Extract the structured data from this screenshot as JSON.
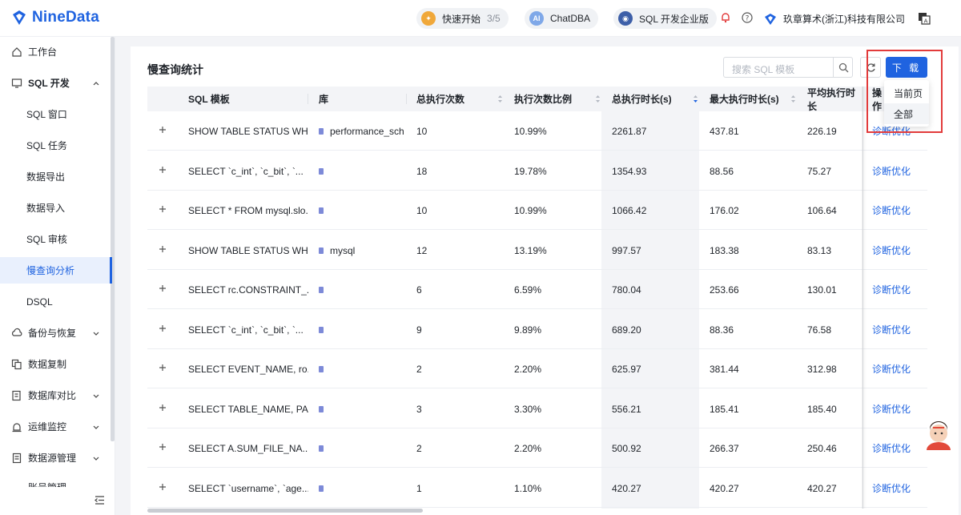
{
  "header": {
    "logo_text": "NineData",
    "quickstart_label": "快速开始",
    "quickstart_count": "3/5",
    "chatdba_label": "ChatDBA",
    "edition_label": "SQL 开发企业版",
    "company_name": "玖章算术(浙江)科技有限公司"
  },
  "sidebar": {
    "items": [
      {
        "label": "工作台",
        "icon": "home-icon"
      },
      {
        "label": "SQL 开发",
        "icon": "monitor-icon"
      },
      {
        "label": "SQL 窗口"
      },
      {
        "label": "SQL 任务"
      },
      {
        "label": "数据导出"
      },
      {
        "label": "数据导入"
      },
      {
        "label": "SQL 审核"
      },
      {
        "label": "慢查询分析"
      },
      {
        "label": "DSQL"
      },
      {
        "label": "备份与恢复",
        "icon": "cloud-icon"
      },
      {
        "label": "数据复制",
        "icon": "copy-icon"
      },
      {
        "label": "数据库对比",
        "icon": "compare-icon"
      },
      {
        "label": "运维监控",
        "icon": "alarm-icon"
      },
      {
        "label": "数据源管理",
        "icon": "datasource-icon"
      },
      {
        "label": "账号管理",
        "icon": "account-icon"
      }
    ]
  },
  "main": {
    "title": "慢查询统计",
    "search_placeholder": "搜索 SQL 模板",
    "download_label": "下 载",
    "download_options": [
      "当前页",
      "全部"
    ],
    "columns": [
      "SQL 模板",
      "库",
      "总执行次数",
      "执行次数比例",
      "总执行时长(s)",
      "最大执行时长(s)",
      "平均执行时长",
      "操作"
    ],
    "rows": [
      {
        "sql": "SHOW TABLE STATUS WH...",
        "db": "performance_sch",
        "count": "10",
        "ratio": "10.99%",
        "total": "2261.87",
        "max": "437.81",
        "avg": "226.19",
        "op": "诊断优化"
      },
      {
        "sql": "SELECT `c_int`, `c_bit`, `...",
        "db": "",
        "count": "18",
        "ratio": "19.78%",
        "total": "1354.93",
        "max": "88.56",
        "avg": "75.27",
        "op": "诊断优化"
      },
      {
        "sql": "SELECT * FROM mysql.slo...",
        "db": "",
        "count": "10",
        "ratio": "10.99%",
        "total": "1066.42",
        "max": "176.02",
        "avg": "106.64",
        "op": "诊断优化"
      },
      {
        "sql": "SHOW TABLE STATUS WH...",
        "db": "mysql",
        "count": "12",
        "ratio": "13.19%",
        "total": "997.57",
        "max": "183.38",
        "avg": "83.13",
        "op": "诊断优化"
      },
      {
        "sql": "SELECT rc.CONSTRAINT_...",
        "db": "",
        "count": "6",
        "ratio": "6.59%",
        "total": "780.04",
        "max": "253.66",
        "avg": "130.01",
        "op": "诊断优化"
      },
      {
        "sql": "SELECT `c_int`, `c_bit`, `...",
        "db": "",
        "count": "9",
        "ratio": "9.89%",
        "total": "689.20",
        "max": "88.36",
        "avg": "76.58",
        "op": "诊断优化"
      },
      {
        "sql": "SELECT EVENT_NAME, ro...",
        "db": "",
        "count": "2",
        "ratio": "2.20%",
        "total": "625.97",
        "max": "381.44",
        "avg": "312.98",
        "op": "诊断优化"
      },
      {
        "sql": "SELECT TABLE_NAME, PA...",
        "db": "",
        "count": "3",
        "ratio": "3.30%",
        "total": "556.21",
        "max": "185.41",
        "avg": "185.40",
        "op": "诊断优化"
      },
      {
        "sql": "SELECT A.SUM_FILE_NA...",
        "db": "",
        "count": "2",
        "ratio": "2.20%",
        "total": "500.92",
        "max": "266.37",
        "avg": "250.46",
        "op": "诊断优化"
      },
      {
        "sql": "SELECT `username`, `age...",
        "db": "",
        "count": "1",
        "ratio": "1.10%",
        "total": "420.27",
        "max": "420.27",
        "avg": "420.27",
        "op": "诊断优化"
      }
    ]
  },
  "colors": {
    "accent": "#1f63e0",
    "highlight": "#e23b3b"
  }
}
